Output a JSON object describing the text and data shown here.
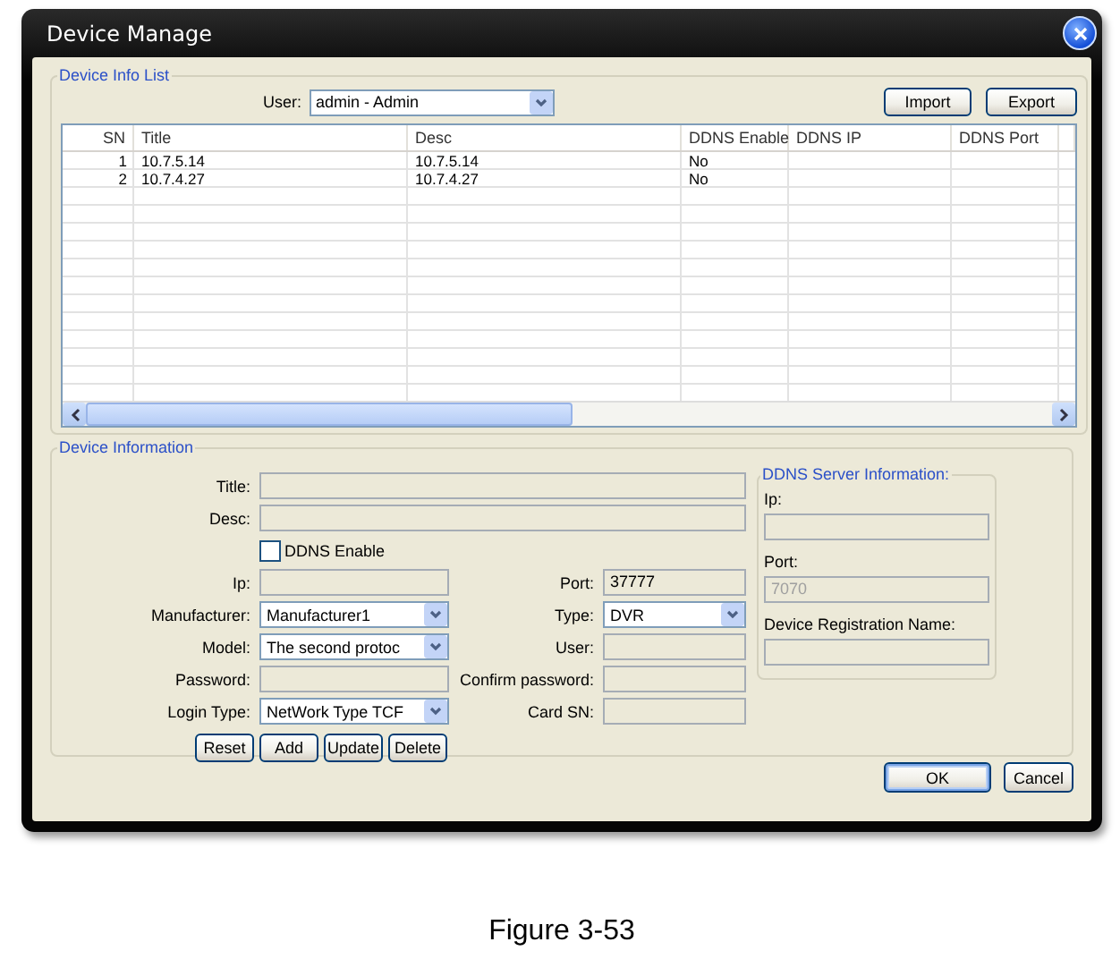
{
  "window": {
    "title": "Device Manage"
  },
  "device_info_list": {
    "legend": "Device Info List",
    "user_label": "User:",
    "user": "admin - Admin",
    "buttons": [
      "Import",
      "Export"
    ],
    "table": {
      "columns": [
        "SN",
        "Title",
        "Desc",
        "DDNS Enable",
        "DDNS IP",
        "DDNS Port"
      ],
      "rows": [
        {
          "sn": "1",
          "title": "10.7.5.14",
          "desc": "10.7.5.14",
          "ddns_enable": "No"
        },
        {
          "sn": "2",
          "title": "10.7.4.27",
          "desc": "10.7.4.27",
          "ddns_enable": "No"
        }
      ]
    }
  },
  "device_information": {
    "legend": "Device Information",
    "title": {
      "label": "Title:"
    },
    "desc": {
      "label": "Desc:"
    },
    "ddns_enable": {
      "label": "DDNS Enable",
      "checked": false
    },
    "rows": [
      {
        "left": {
          "label": "Ip:",
          "kind": "text"
        },
        "right": {
          "label": "Port:",
          "kind": "text",
          "value": "37777"
        }
      },
      {
        "left": {
          "label": "Manufacturer:",
          "kind": "select",
          "value": "Manufacturer1"
        },
        "right": {
          "label": "Type:",
          "kind": "select",
          "value": "DVR"
        }
      },
      {
        "left": {
          "label": "Model:",
          "kind": "select",
          "value": "The second protoc"
        },
        "right": {
          "label": "User:",
          "kind": "text"
        }
      },
      {
        "left": {
          "label": "Password:",
          "kind": "text"
        },
        "right": {
          "label": "Confirm password:",
          "kind": "text"
        }
      },
      {
        "left": {
          "label": "Login Type:",
          "kind": "select",
          "value": "NetWork Type TCF"
        },
        "right": {
          "label": "Card SN:",
          "kind": "text"
        }
      }
    ],
    "buttons": [
      "Reset",
      "Add",
      "Update",
      "Delete"
    ],
    "ddns_server": {
      "legend": "DDNS Server Information:",
      "fields": [
        {
          "label": "Ip:"
        },
        {
          "label": "Port:",
          "placeholder": "7070"
        },
        {
          "label": "Device Registration Name:"
        }
      ]
    }
  },
  "footer_buttons": [
    {
      "label": "OK",
      "default": true
    },
    {
      "label": "Cancel",
      "default": false
    }
  ],
  "caption": "Figure 3-53"
}
